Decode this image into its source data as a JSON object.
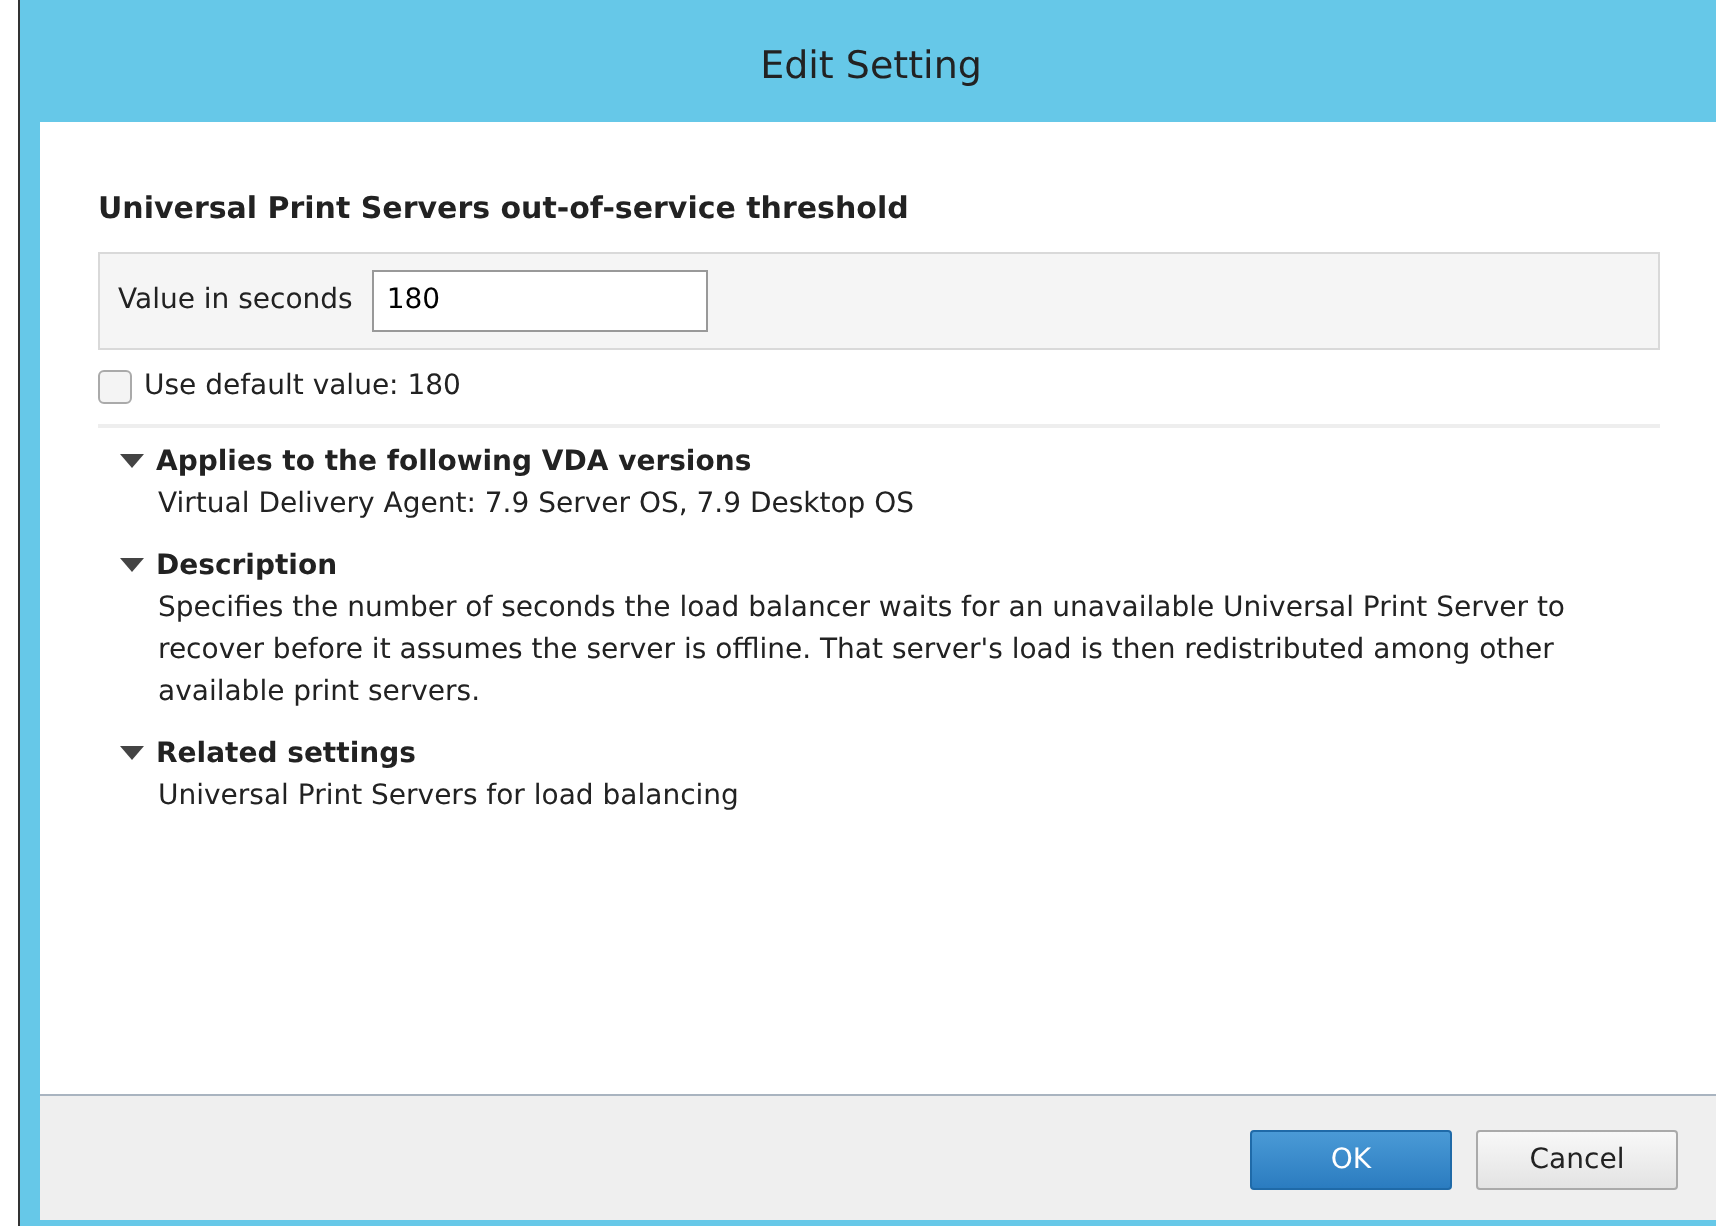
{
  "window": {
    "title": "Edit Setting"
  },
  "setting": {
    "title": "Universal Print Servers out-of-service threshold",
    "value_label": "Value in seconds",
    "value": "180"
  },
  "use_default": {
    "label": "Use default value: 180",
    "checked": false
  },
  "sections": [
    {
      "title": "Applies to the following VDA versions",
      "expanded": true,
      "body": "Virtual Delivery Agent: 7.9 Server OS, 7.9 Desktop OS"
    },
    {
      "title": "Description",
      "expanded": true,
      "body": "Specifies the number of seconds the load balancer waits for an unavailable Universal Print Server to recover before it assumes the server is offline. That server's load is then redistributed among other available print servers."
    },
    {
      "title": "Related settings",
      "expanded": true,
      "body": "Universal Print Servers for load balancing"
    }
  ],
  "buttons": [
    {
      "label": "OK",
      "kind": "primary"
    },
    {
      "label": "Cancel",
      "kind": "secondary"
    }
  ]
}
